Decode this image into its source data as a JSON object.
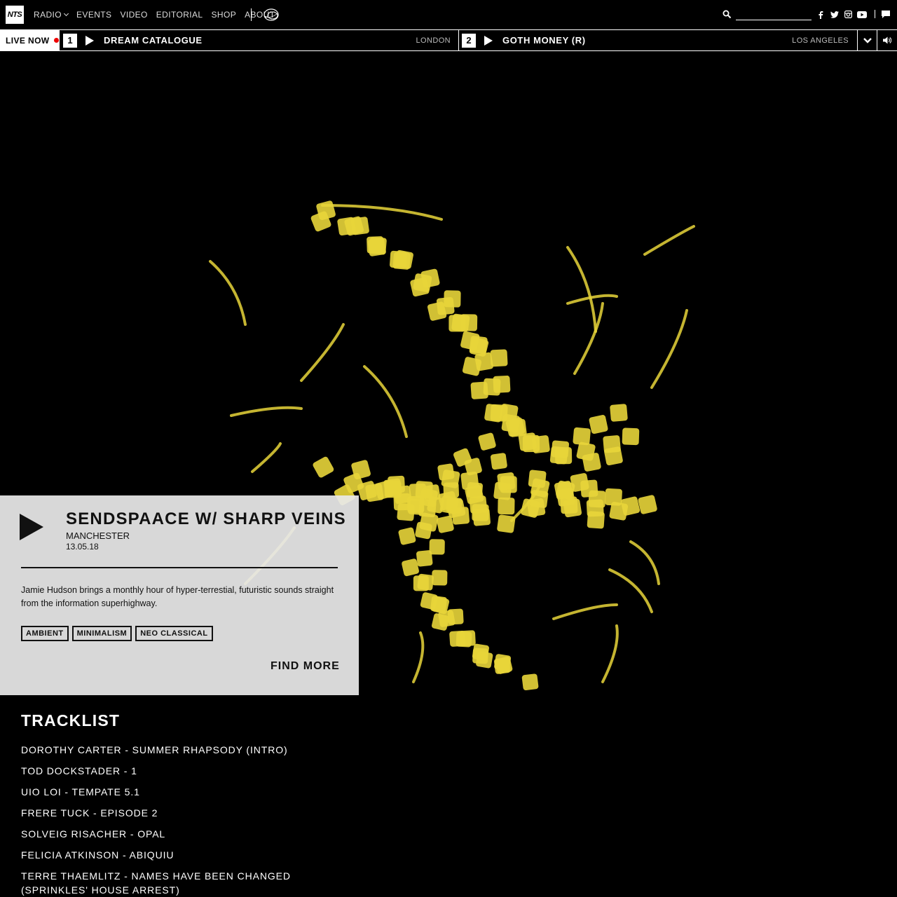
{
  "nav": {
    "logo": "NTS",
    "items": [
      "RADIO",
      "EVENTS",
      "VIDEO",
      "EDITORIAL",
      "SHOP",
      "ABOUT"
    ],
    "search_placeholder": "",
    "social": [
      "facebook-icon",
      "twitter-icon",
      "instagram-icon",
      "youtube-icon",
      "chat-icon"
    ]
  },
  "live": {
    "label": "LIVE NOW",
    "channels": [
      {
        "number": "1",
        "title": "DREAM CATALOGUE",
        "location": "LONDON"
      },
      {
        "number": "2",
        "title": "GOTH MONEY (R)",
        "location": "LOS ANGELES"
      }
    ]
  },
  "episode": {
    "title": "SENDSPAACE W/ SHARP VEINS",
    "location": "MANCHESTER",
    "date": "13.05.18",
    "description": "Jamie Hudson brings a monthly hour of hyper-terrestial, futuristic sounds straight from the information superhighway.",
    "tags": [
      "AMBIENT",
      "MINIMALISM",
      "NEO CLASSICAL"
    ],
    "find_more": "FIND MORE"
  },
  "tracklist": {
    "title": "TRACKLIST",
    "tracks": [
      "DOROTHY CARTER - SUMMER RHAPSODY (INTRO)",
      "TOD DOCKSTADER - 1",
      "UIO LOI - TEMPATE 5.1",
      "FRERE TUCK - EPISODE 2",
      "SOLVEIG RISACHER - OPAL",
      "FELICIA ATKINSON - ABIQUIU",
      "TERRE THAEMLITZ - NAMES HAVE BEEN CHANGED (SPRINKLES' HOUSE ARREST)"
    ]
  },
  "colors": {
    "background": "#000000",
    "artwork": "#e8d53a",
    "card": "#e8e8e8",
    "live_dot": "#ee0000"
  }
}
